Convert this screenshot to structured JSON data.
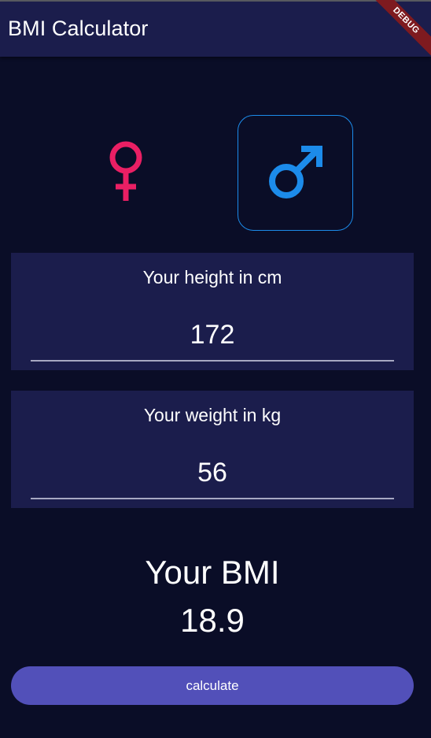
{
  "app_bar": {
    "title": "BMI Calculator",
    "debug_label": "DEBUG"
  },
  "gender": {
    "options": [
      {
        "icon": "female-symbol-icon",
        "color": "#ea1f64",
        "selected": false
      },
      {
        "icon": "male-symbol-icon",
        "color": "#1c8bea",
        "selected": true
      }
    ]
  },
  "height_card": {
    "label": "Your height in cm",
    "value": "172"
  },
  "weight_card": {
    "label": "Your weight in kg",
    "value": "56"
  },
  "result": {
    "title": "Your BMI",
    "value": "18.9"
  },
  "calculate_button": {
    "label": "calculate"
  },
  "colors": {
    "background": "#0a0d27",
    "card": "#1b1d4c",
    "accent_female": "#ea1f64",
    "accent_male": "#1c8bea",
    "button": "#5250b9"
  }
}
